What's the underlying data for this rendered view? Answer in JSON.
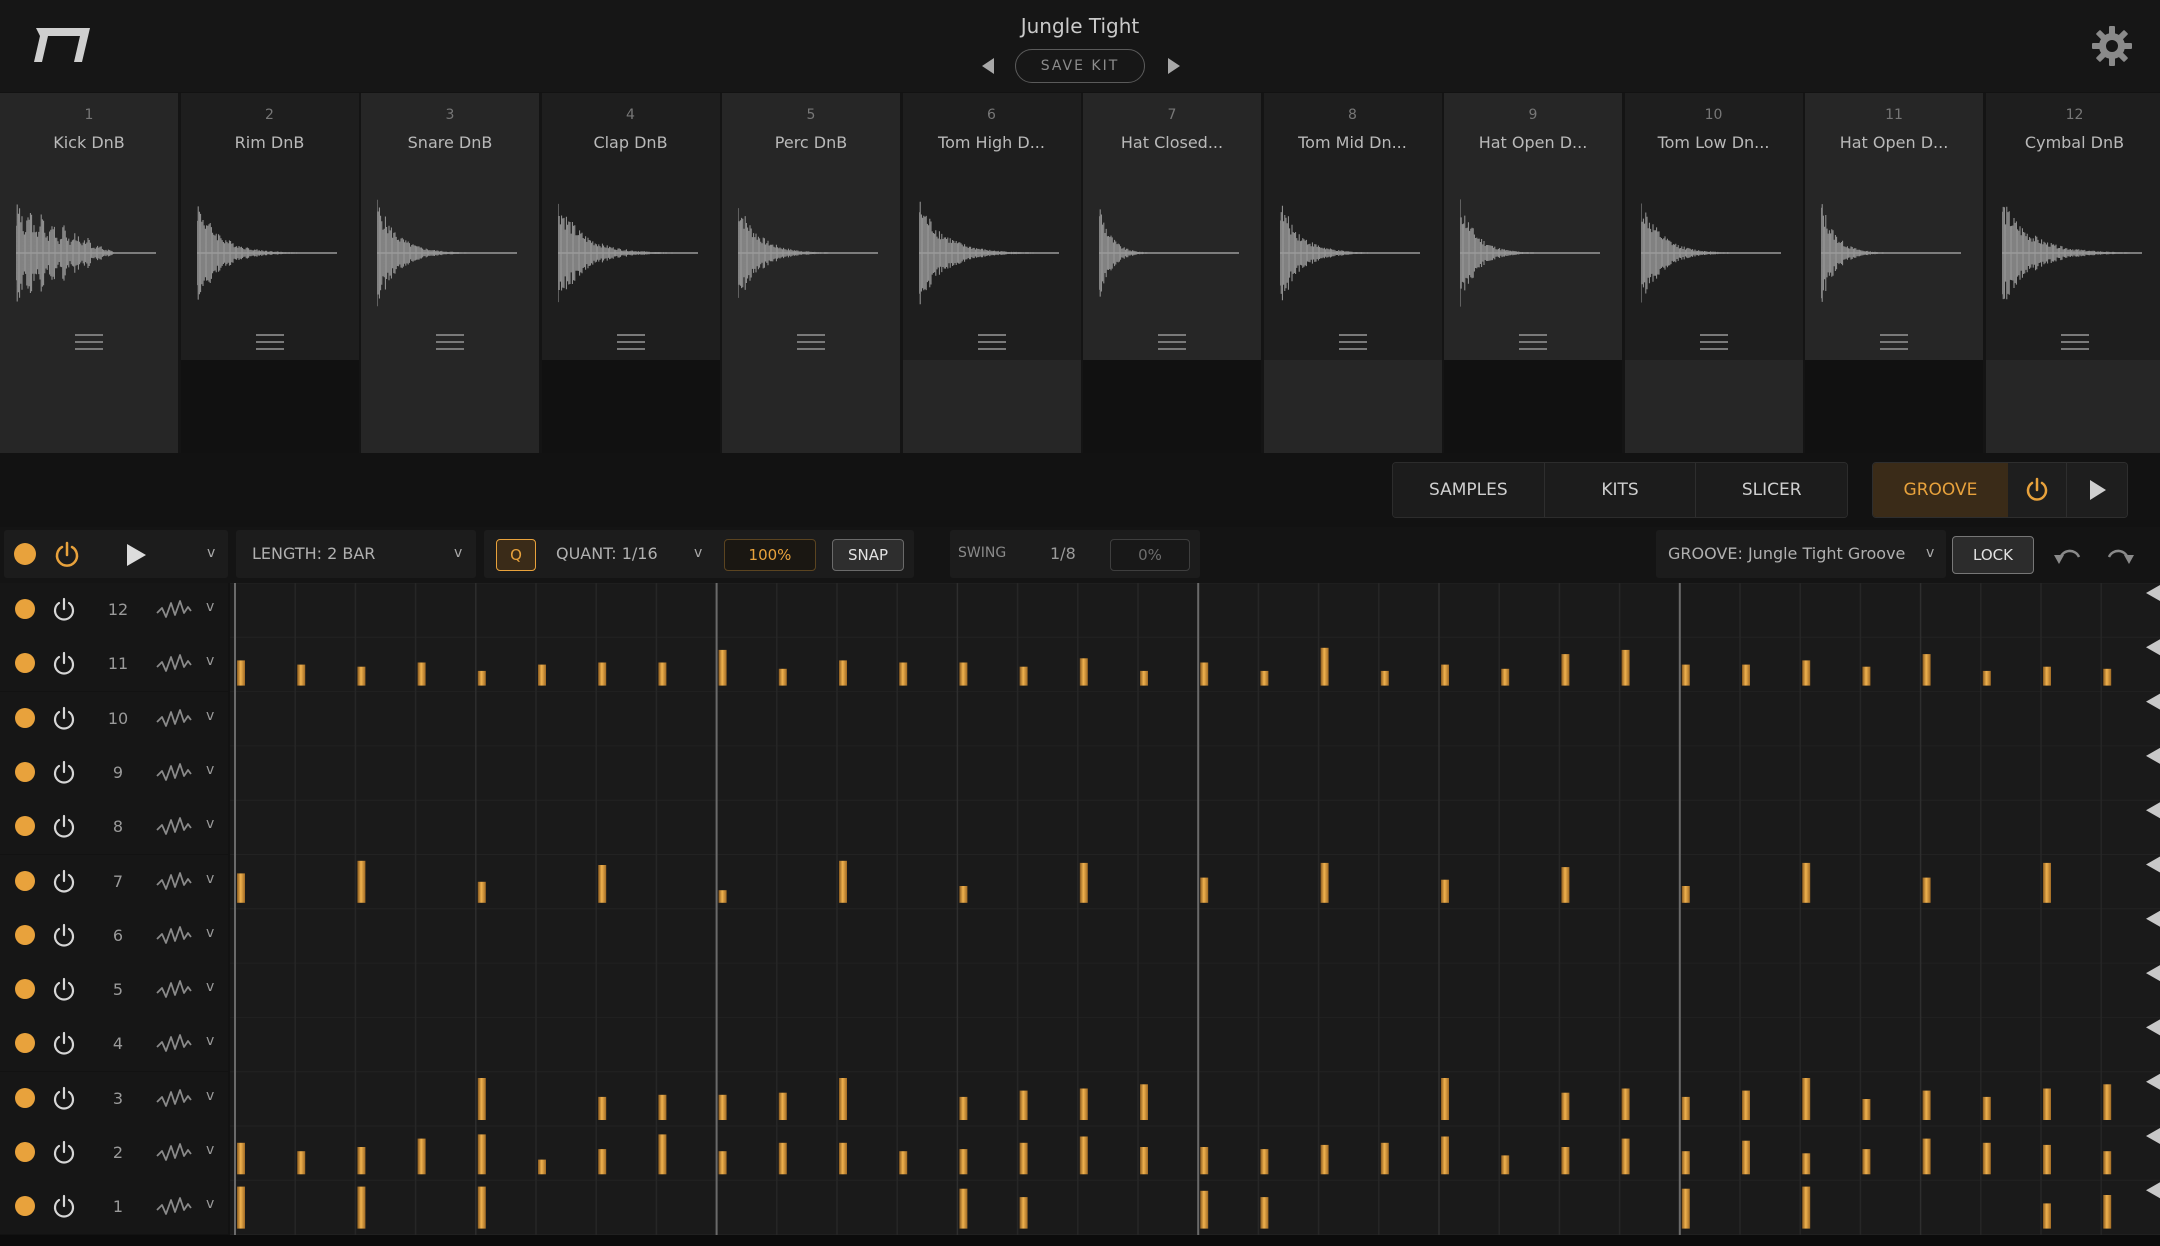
{
  "header": {
    "kit_name": "Jungle Tight",
    "save_kit_label": "SAVE KIT"
  },
  "pads": [
    {
      "number": "1",
      "name": "Kick DnB"
    },
    {
      "number": "2",
      "name": "Rim DnB"
    },
    {
      "number": "3",
      "name": "Snare DnB"
    },
    {
      "number": "4",
      "name": "Clap DnB"
    },
    {
      "number": "5",
      "name": "Perc DnB"
    },
    {
      "number": "6",
      "name": "Tom High D..."
    },
    {
      "number": "7",
      "name": "Hat Closed..."
    },
    {
      "number": "8",
      "name": "Tom Mid Dn..."
    },
    {
      "number": "9",
      "name": "Hat Open D..."
    },
    {
      "number": "10",
      "name": "Tom Low Dn..."
    },
    {
      "number": "11",
      "name": "Hat Open D..."
    },
    {
      "number": "12",
      "name": "Cymbal DnB"
    }
  ],
  "tabs": {
    "samples": "SAMPLES",
    "kits": "KITS",
    "slicer": "SLICER",
    "groove": "GROOVE"
  },
  "toolbar": {
    "length_label": "LENGTH: 2 BAR",
    "q_label": "Q",
    "quant_label": "QUANT: 1/16",
    "quant_amount": "100%",
    "snap_label": "SNAP",
    "swing_label": "SWING",
    "swing_division": "1/8",
    "swing_amount": "0%",
    "groove_select": "GROOVE: Jungle Tight Groove",
    "lock_label": "LOCK",
    "chevron": "v"
  },
  "rows": [
    {
      "number": "12",
      "chevron": "v"
    },
    {
      "number": "11",
      "chevron": "v"
    },
    {
      "number": "10",
      "chevron": "v"
    },
    {
      "number": "9",
      "chevron": "v"
    },
    {
      "number": "8",
      "chevron": "v"
    },
    {
      "number": "7",
      "chevron": "v"
    },
    {
      "number": "6",
      "chevron": "v"
    },
    {
      "number": "5",
      "chevron": "v"
    },
    {
      "number": "4",
      "chevron": "v"
    },
    {
      "number": "3",
      "chevron": "v"
    },
    {
      "number": "2",
      "chevron": "v"
    },
    {
      "number": "1",
      "chevron": "v"
    }
  ],
  "pattern": {
    "steps": 32,
    "velocity_levels": "0-1",
    "lanes": {
      "11": [
        [
          0,
          0.6
        ],
        [
          1,
          0.5
        ],
        [
          2,
          0.45
        ],
        [
          3,
          0.55
        ],
        [
          4,
          0.35
        ],
        [
          5,
          0.5
        ],
        [
          6,
          0.55
        ],
        [
          7,
          0.55
        ],
        [
          8,
          0.85
        ],
        [
          9,
          0.4
        ],
        [
          10,
          0.6
        ],
        [
          11,
          0.55
        ],
        [
          12,
          0.55
        ],
        [
          13,
          0.45
        ],
        [
          14,
          0.65
        ],
        [
          15,
          0.35
        ],
        [
          16,
          0.55
        ],
        [
          17,
          0.35
        ],
        [
          18,
          0.9
        ],
        [
          19,
          0.35
        ],
        [
          20,
          0.5
        ],
        [
          21,
          0.4
        ],
        [
          22,
          0.75
        ],
        [
          23,
          0.85
        ],
        [
          24,
          0.5
        ],
        [
          25,
          0.5
        ],
        [
          26,
          0.6
        ],
        [
          27,
          0.45
        ],
        [
          28,
          0.75
        ],
        [
          29,
          0.35
        ],
        [
          30,
          0.45
        ],
        [
          31,
          0.4
        ]
      ],
      "7": [
        [
          0,
          0.7
        ],
        [
          2,
          1.0
        ],
        [
          4,
          0.5
        ],
        [
          6,
          0.9
        ],
        [
          8,
          0.3
        ],
        [
          10,
          1.0
        ],
        [
          12,
          0.4
        ],
        [
          14,
          0.95
        ],
        [
          16,
          0.6
        ],
        [
          18,
          0.95
        ],
        [
          20,
          0.55
        ],
        [
          22,
          0.85
        ],
        [
          24,
          0.4
        ],
        [
          26,
          0.95
        ],
        [
          28,
          0.6
        ],
        [
          30,
          0.95
        ]
      ],
      "3": [
        [
          4,
          1.0
        ],
        [
          6,
          0.55
        ],
        [
          7,
          0.6
        ],
        [
          8,
          0.6
        ],
        [
          9,
          0.65
        ],
        [
          10,
          1.0
        ],
        [
          12,
          0.55
        ],
        [
          13,
          0.7
        ],
        [
          14,
          0.75
        ],
        [
          15,
          0.85
        ],
        [
          20,
          1.0
        ],
        [
          22,
          0.65
        ],
        [
          23,
          0.75
        ],
        [
          24,
          0.55
        ],
        [
          25,
          0.7
        ],
        [
          26,
          1.0
        ],
        [
          27,
          0.5
        ],
        [
          28,
          0.7
        ],
        [
          29,
          0.55
        ],
        [
          30,
          0.75
        ],
        [
          31,
          0.85
        ]
      ],
      "2": [
        [
          0,
          0.75
        ],
        [
          1,
          0.55
        ],
        [
          2,
          0.65
        ],
        [
          3,
          0.85
        ],
        [
          4,
          0.95
        ],
        [
          5,
          0.35
        ],
        [
          6,
          0.6
        ],
        [
          7,
          0.95
        ],
        [
          8,
          0.55
        ],
        [
          9,
          0.75
        ],
        [
          10,
          0.75
        ],
        [
          11,
          0.55
        ],
        [
          12,
          0.6
        ],
        [
          13,
          0.75
        ],
        [
          14,
          0.9
        ],
        [
          15,
          0.65
        ],
        [
          16,
          0.65
        ],
        [
          17,
          0.6
        ],
        [
          18,
          0.7
        ],
        [
          19,
          0.75
        ],
        [
          20,
          0.9
        ],
        [
          21,
          0.45
        ],
        [
          22,
          0.65
        ],
        [
          23,
          0.85
        ],
        [
          24,
          0.55
        ],
        [
          25,
          0.8
        ],
        [
          26,
          0.5
        ],
        [
          27,
          0.6
        ],
        [
          28,
          0.85
        ],
        [
          29,
          0.75
        ],
        [
          30,
          0.7
        ],
        [
          31,
          0.55
        ]
      ],
      "1": [
        [
          0,
          1.0
        ],
        [
          2,
          1.0
        ],
        [
          4,
          1.0
        ],
        [
          12,
          0.95
        ],
        [
          13,
          0.75
        ],
        [
          16,
          0.9
        ],
        [
          17,
          0.75
        ],
        [
          24,
          0.95
        ],
        [
          26,
          1.0
        ],
        [
          30,
          0.6
        ],
        [
          31,
          0.8
        ]
      ]
    }
  },
  "colors": {
    "accent": "#e8a23c",
    "groove_active_bg": "#3a2b18",
    "background": "#121212"
  },
  "icons": {
    "logo": "logo-icon",
    "settings": "gear-icon",
    "prev": "triangle-left-icon",
    "next": "triangle-right-icon",
    "power": "power-icon",
    "play": "play-icon",
    "undo": "undo-icon",
    "redo": "redo-icon"
  }
}
